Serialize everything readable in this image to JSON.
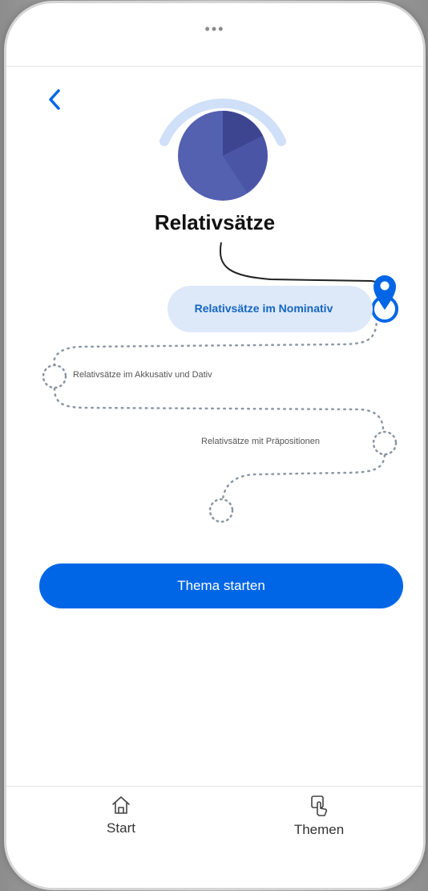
{
  "header": {
    "dots": "•••",
    "back_icon": "chevron-left-icon"
  },
  "topic": {
    "title": "Relativsätze",
    "icon": "circle-progress-icon"
  },
  "path": {
    "current_step": "Relativsätze im Nominativ",
    "steps": [
      "Relativsätze im Akkusativ und Dativ",
      "Relativsätze mit Präpositionen"
    ]
  },
  "actions": {
    "start_label": "Thema starten"
  },
  "bottom_nav": {
    "items": [
      {
        "label": "Start",
        "icon": "home-icon"
      },
      {
        "label": "Themen",
        "icon": "tap-icon"
      }
    ]
  },
  "colors": {
    "accent": "#0066e6",
    "bubble": "#dde9f9",
    "arc": "#cfe0f8",
    "circle": "#5460b0"
  }
}
